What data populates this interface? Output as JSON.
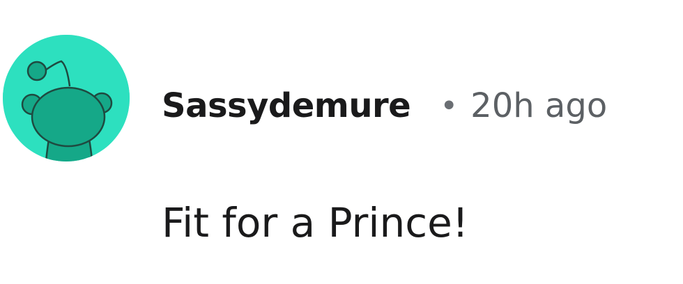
{
  "comment": {
    "author": "Sassydemure",
    "separator": "•",
    "timestamp": "20h ago",
    "body": "Fit for a Prince!"
  },
  "avatar": {
    "icon": "snoo-avatar-icon",
    "background_color": "#2de0bf",
    "figure_color": "#15a888"
  }
}
